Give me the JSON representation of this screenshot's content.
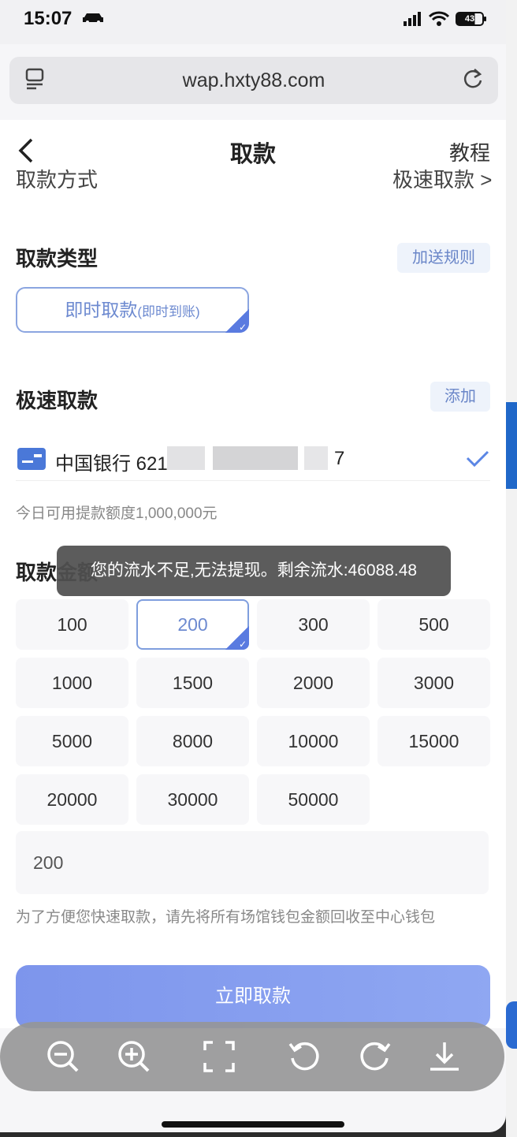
{
  "status": {
    "time": "15:07",
    "battery": "43"
  },
  "browser": {
    "url": "wap.hxty88.com"
  },
  "nav": {
    "title": "取款",
    "tutorial": "教程"
  },
  "clipped_row": {
    "left": "取款方式",
    "right": "极速取款 >"
  },
  "withdraw_type": {
    "title": "取款类型",
    "rules_button": "加送规则",
    "option_main": "即时取款",
    "option_sub": "(即时到账)"
  },
  "fast_withdraw": {
    "title": "极速取款",
    "add_button": "添加",
    "bank_name": "中国银行 621",
    "bank_last": "7"
  },
  "limit_text": "今日可用提款额度1,000,000元",
  "amount": {
    "title": "取款金额",
    "options": [
      "100",
      "200",
      "300",
      "500",
      "1000",
      "1500",
      "2000",
      "3000",
      "5000",
      "8000",
      "10000",
      "15000",
      "20000",
      "30000",
      "50000"
    ],
    "selected": "200",
    "input_value": "200"
  },
  "hint": "为了方便您快速取款，请先将所有场馆钱包金额回收至中心钱包",
  "submit_label": "立即取款",
  "toast": "您的流水不足,无法提现。剩余流水:46088.48",
  "colors": {
    "accent": "#7d95ec",
    "selected_border": "#7f9ede",
    "toast_bg": "#505050"
  },
  "toolbar_icons": [
    "zoom-out-icon",
    "zoom-in-icon",
    "fullscreen-icon",
    "rotate-left-icon",
    "rotate-right-icon",
    "download-icon"
  ]
}
